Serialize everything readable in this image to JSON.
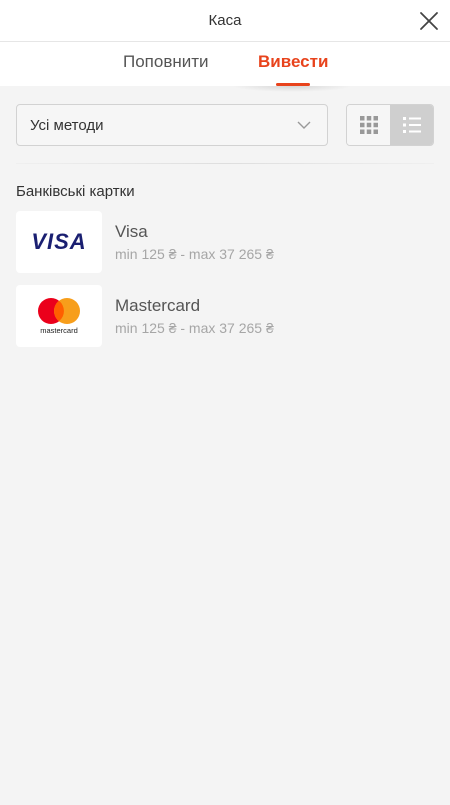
{
  "header": {
    "title": "Каса",
    "close_icon": "close-icon"
  },
  "tabs": [
    {
      "label": "Поповнити",
      "active": false
    },
    {
      "label": "Вивести",
      "active": true
    }
  ],
  "accent_color": "#e8431c",
  "filter": {
    "selected": "Усі методи",
    "icon": "chevron-down-icon"
  },
  "view_toggle": {
    "options": [
      "grid-icon",
      "list-icon"
    ],
    "active": "list-icon"
  },
  "sections": [
    {
      "title": "Банківські картки",
      "methods": [
        {
          "name": "Visa",
          "limits": "min 125 ₴ - max 37 265 ₴",
          "logo_text": "VISA"
        },
        {
          "name": "Mastercard",
          "limits": "min 125 ₴ - max 37 265 ₴",
          "logo_text": "mastercard"
        }
      ]
    }
  ]
}
